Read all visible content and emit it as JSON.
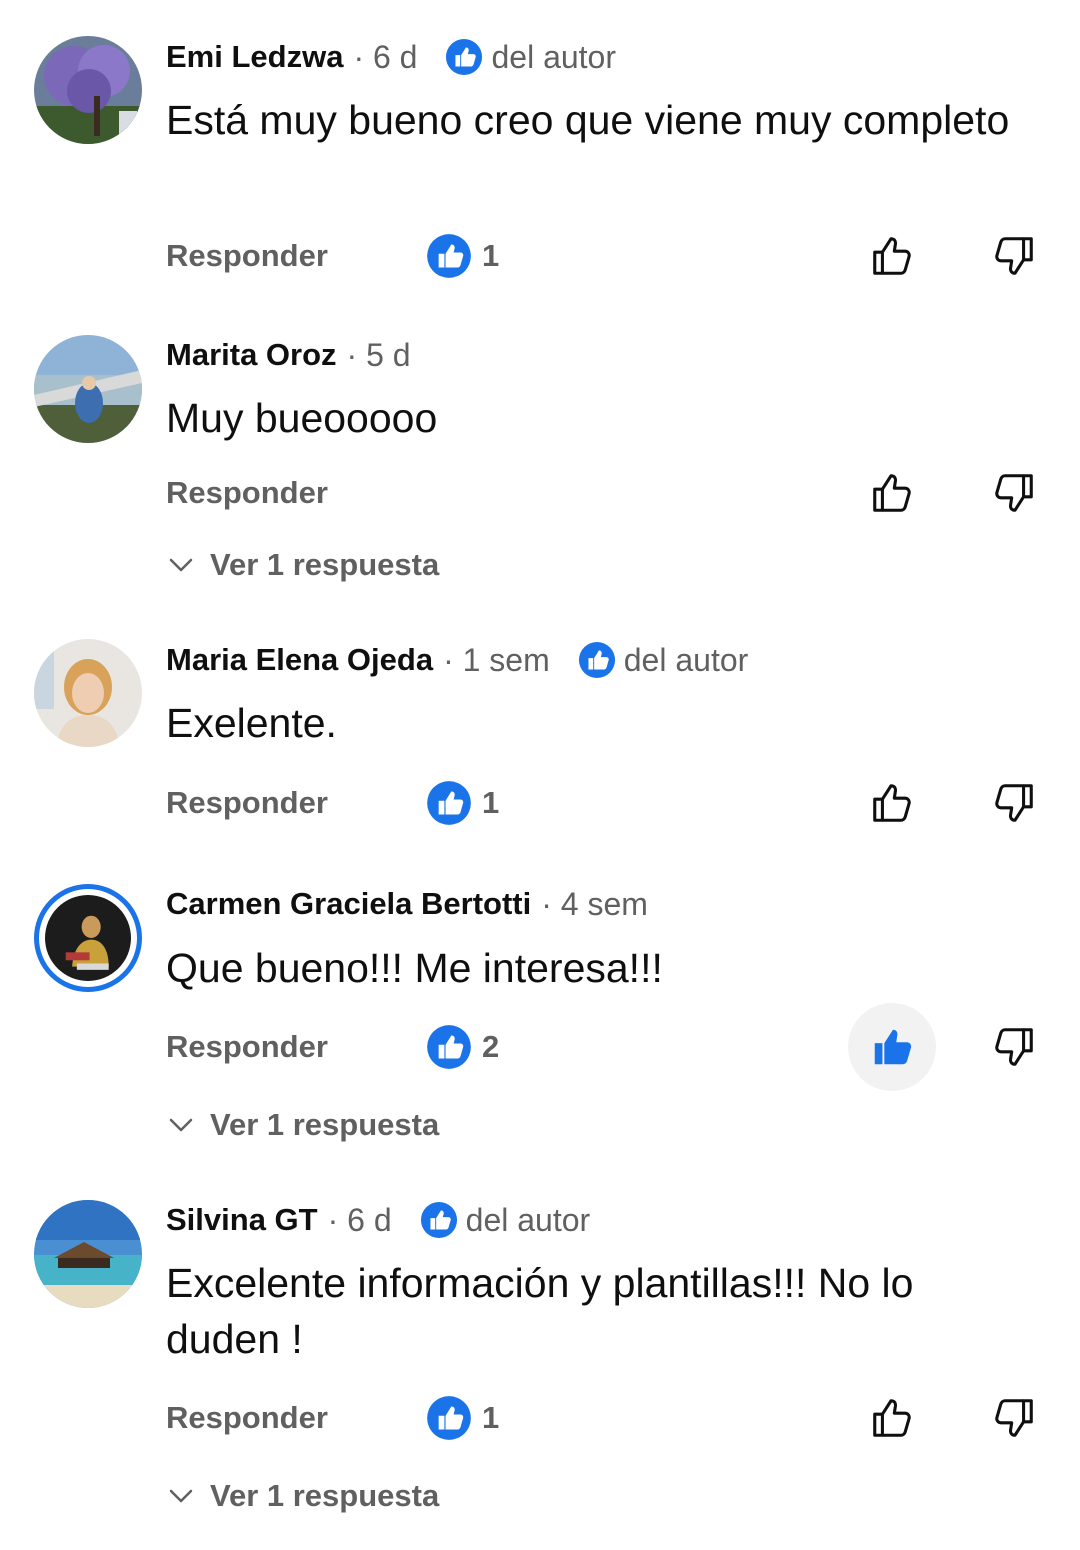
{
  "colors": {
    "accent": "#1a73e8",
    "secondary_text": "#606060",
    "primary_text": "#0f0f0f"
  },
  "icons": {
    "like_badge": "heart-like-badge-icon",
    "like": "thumb-up-icon",
    "dislike": "thumb-down-icon",
    "expand": "chevron-down-icon"
  },
  "comments": [
    {
      "author": "Emi Ledzwa",
      "time": "· 6 d",
      "author_liked": true,
      "author_liked_label": "del autor",
      "text": "Está muy bueno creo que viene muy completo",
      "reply_label": "Responder",
      "like_count": "1",
      "user_liked": false,
      "replies_label": ""
    },
    {
      "author": "Marita Oroz",
      "time": "· 5 d",
      "author_liked": false,
      "author_liked_label": "",
      "text": "Muy bueooooo",
      "reply_label": "Responder",
      "like_count": "",
      "user_liked": false,
      "replies_label": "Ver 1 respuesta"
    },
    {
      "author": "Maria Elena Ojeda",
      "time": "· 1 sem",
      "author_liked": true,
      "author_liked_label": "del autor",
      "text": "Exelente.",
      "reply_label": "Responder",
      "like_count": "1",
      "user_liked": false,
      "replies_label": ""
    },
    {
      "author": "Carmen Graciela Bertotti",
      "time": "· 4 sem",
      "author_liked": false,
      "author_liked_label": "",
      "text": "Que bueno!!! Me interesa!!!",
      "reply_label": "Responder",
      "like_count": "2",
      "user_liked": true,
      "replies_label": "Ver 1 respuesta"
    },
    {
      "author": "Silvina GT",
      "time": "· 6 d",
      "author_liked": true,
      "author_liked_label": "del autor",
      "text": "Excelente información y plantillas!!! No lo duden !",
      "reply_label": "Responder",
      "like_count": "1",
      "user_liked": false,
      "replies_label": "Ver 1 respuesta"
    }
  ]
}
